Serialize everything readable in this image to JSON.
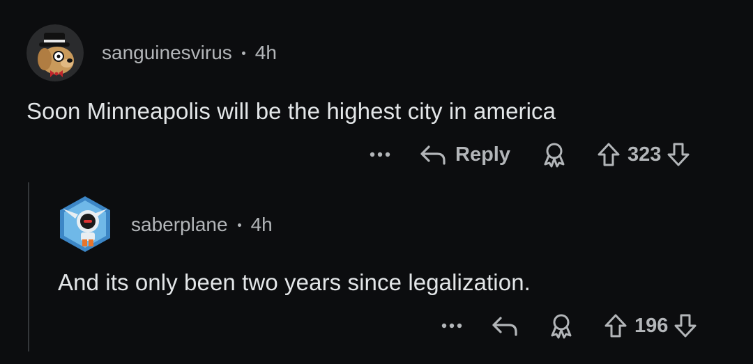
{
  "comments": [
    {
      "username": "sanguinesvirus",
      "time": "4h",
      "text": "Soon Minneapolis will be the highest city in america",
      "reply_label": "Reply",
      "score": "323",
      "avatar_icon": "dog-with-top-hat-avatar"
    },
    {
      "username": "saberplane",
      "time": "4h",
      "text": "And its only been two years since legalization.",
      "score": "196",
      "avatar_icon": "robot-hexagon-avatar"
    }
  ],
  "colors": {
    "background": "#0c0d0f",
    "text": "#e3e6e8",
    "muted": "#b3b6b9",
    "thread_line": "#34373a"
  }
}
